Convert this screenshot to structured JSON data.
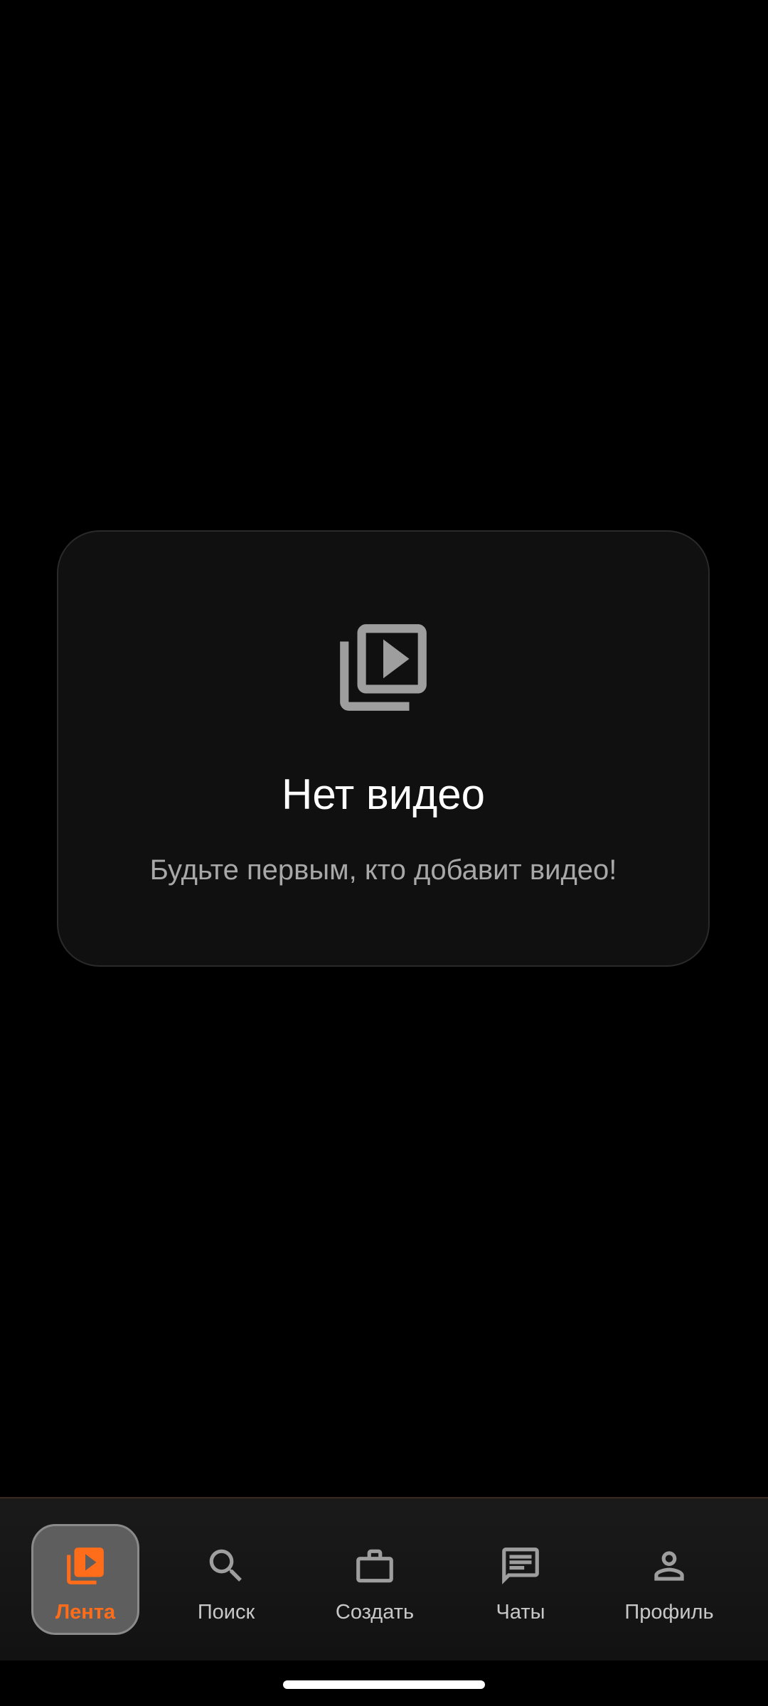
{
  "empty_state": {
    "icon": "video-library-icon",
    "title": "Нет видео",
    "subtitle": "Будьте первым, кто добавит видео!"
  },
  "bottom_nav": {
    "items": [
      {
        "label": "Лента",
        "icon": "video-library-icon",
        "active": true
      },
      {
        "label": "Поиск",
        "icon": "search-icon",
        "active": false
      },
      {
        "label": "Создать",
        "icon": "briefcase-icon",
        "active": false
      },
      {
        "label": "Чаты",
        "icon": "chat-icon",
        "active": false
      },
      {
        "label": "Профиль",
        "icon": "person-icon",
        "active": false
      }
    ]
  },
  "colors": {
    "background": "#000000",
    "card": "#101010",
    "accent": "#ff6d1a",
    "icon_muted": "#9e9e9e",
    "nav_text": "#c8c8c8"
  }
}
